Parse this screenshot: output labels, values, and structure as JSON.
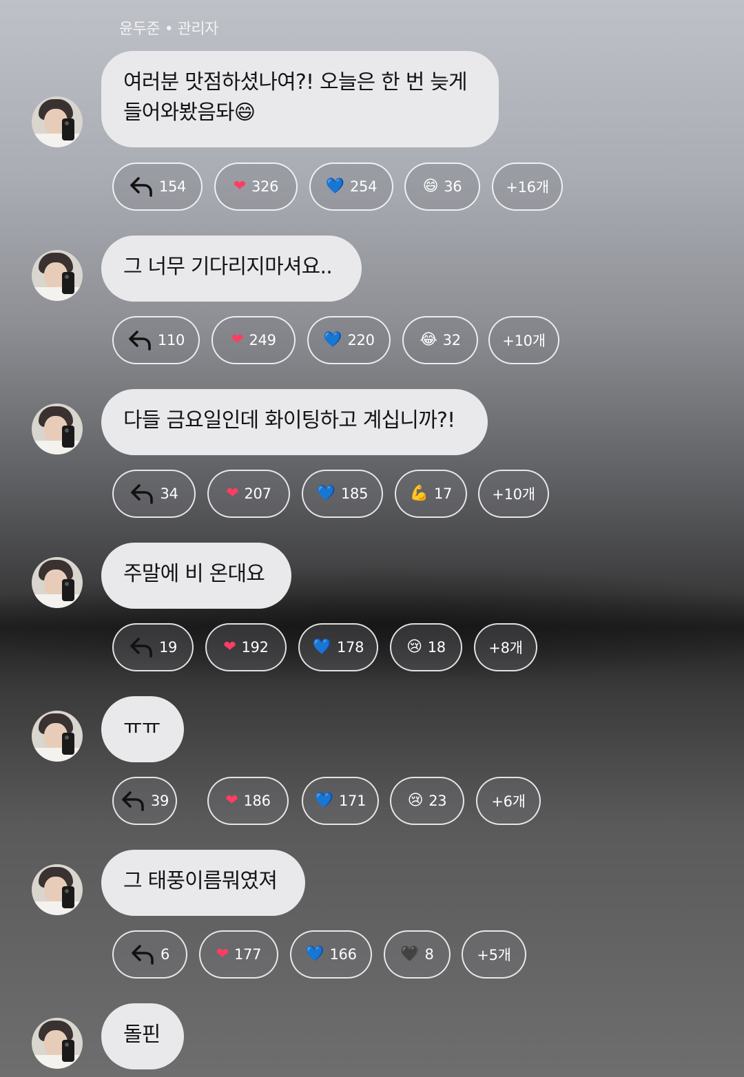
{
  "sender_line": "윤두준 • 관리자",
  "messages": [
    {
      "lines": [
        "여러분 맛점하셨나여?! 오늘은 한 번 늦게",
        "들어와봤음돠😄"
      ],
      "replies": "154",
      "reactions": [
        {
          "icon": "red-heart-icon",
          "glyph": "❤",
          "count": "326"
        },
        {
          "icon": "blue-heart-icon",
          "glyph": "💙",
          "count": "254"
        },
        {
          "icon": "grinning-face-icon",
          "glyph": "😄",
          "count": "36"
        }
      ],
      "more": "+16개"
    },
    {
      "lines": [
        "그 너무 기다리지마셔요.."
      ],
      "replies": "110",
      "reactions": [
        {
          "icon": "red-heart-icon",
          "glyph": "❤",
          "count": "249"
        },
        {
          "icon": "blue-heart-icon",
          "glyph": "💙",
          "count": "220"
        },
        {
          "icon": "tears-of-joy-icon",
          "glyph": "😂",
          "count": "32"
        }
      ],
      "more": "+10개"
    },
    {
      "lines": [
        "다들 금요일인데 화이팅하고 계십니까?!"
      ],
      "replies": "34",
      "reactions": [
        {
          "icon": "red-heart-icon",
          "glyph": "❤",
          "count": "207"
        },
        {
          "icon": "blue-heart-icon",
          "glyph": "💙",
          "count": "185"
        },
        {
          "icon": "flexed-biceps-icon",
          "glyph": "💪",
          "count": "17"
        }
      ],
      "more": "+10개"
    },
    {
      "lines": [
        "주말에 비 온대요"
      ],
      "replies": "19",
      "reactions": [
        {
          "icon": "red-heart-icon",
          "glyph": "❤",
          "count": "192"
        },
        {
          "icon": "blue-heart-icon",
          "glyph": "💙",
          "count": "178"
        },
        {
          "icon": "crying-face-icon",
          "glyph": "😢",
          "count": "18"
        }
      ],
      "more": "+8개"
    },
    {
      "lines": [
        "ㅠㅠ"
      ],
      "replies": "39",
      "reactions": [
        {
          "icon": "red-heart-icon",
          "glyph": "❤",
          "count": "186"
        },
        {
          "icon": "blue-heart-icon",
          "glyph": "💙",
          "count": "171"
        },
        {
          "icon": "crying-face-icon",
          "glyph": "😢",
          "count": "23"
        }
      ],
      "more": "+6개"
    },
    {
      "lines": [
        "그 태풍이름뭐였져"
      ],
      "replies": "6",
      "reactions": [
        {
          "icon": "red-heart-icon",
          "glyph": "❤",
          "count": "177"
        },
        {
          "icon": "blue-heart-icon",
          "glyph": "💙",
          "count": "166"
        },
        {
          "icon": "black-heart-icon",
          "glyph": "🖤",
          "count": "8"
        }
      ],
      "more": "+5개"
    },
    {
      "lines": [
        "돌핀"
      ]
    }
  ],
  "colors": {
    "bubble_bg": "#e9e9eb",
    "red_heart": "#ff3d63",
    "blue_heart": "#2a8cff",
    "black_heart": "#1a1a1a"
  }
}
